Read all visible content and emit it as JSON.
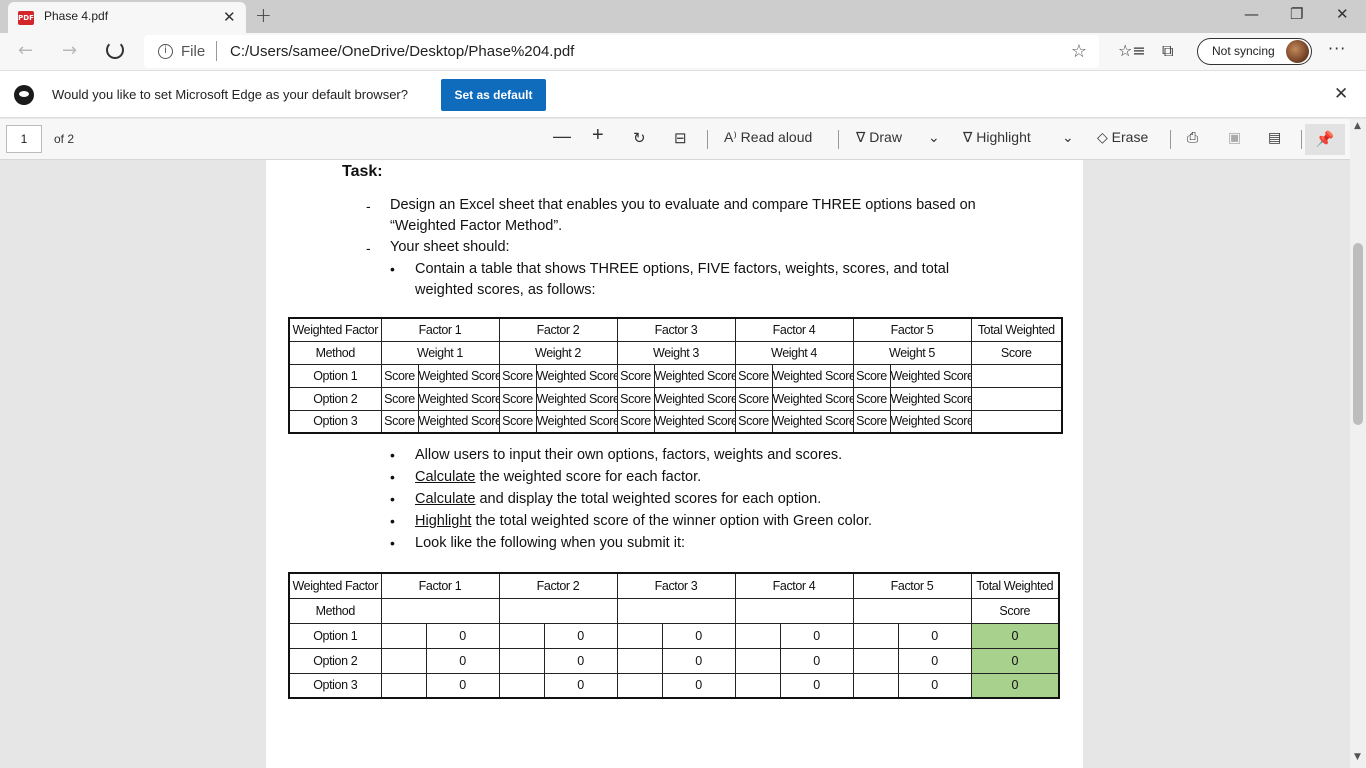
{
  "browser": {
    "tab_title": "Phase 4.pdf",
    "tab_icon_text": "PDF",
    "url_scheme_label": "File",
    "url": "C:/Users/samee/OneDrive/Desktop/Phase%204.pdf",
    "sync_label": "Not syncing"
  },
  "infobar": {
    "message": "Would you like to set Microsoft Edge as your default browser?",
    "button_label": "Set as default"
  },
  "pdf_toolbar": {
    "page_number": "1",
    "page_count": "of 2",
    "read_aloud": "Read aloud",
    "draw": "Draw",
    "highlight": "Highlight",
    "erase": "Erase"
  },
  "doc": {
    "task_heading": "Task:",
    "dash": "-",
    "item1_line1": "Design an Excel sheet that enables you to evaluate and compare THREE options based on",
    "item1_line2": "“Weighted Factor Method”.",
    "item2": "Your sheet should:",
    "bullet": "•",
    "sub1_line1": "Contain a table that shows THREE options, FIVE factors, weights, scores, and total",
    "sub1_line2": "weighted scores, as follows:",
    "req1": "Allow users to input their own options, factors, weights and scores.",
    "req2_u": "Calculate",
    "req2_rest": " the weighted score for each factor.",
    "req3_u": "Calculate",
    "req3_rest": " and display the total weighted scores for each option.",
    "req4_u": "Highlight",
    "req4_rest": " the total weighted score of the winner option with Green color.",
    "req5": "Look like the following when you submit it:"
  },
  "table1": {
    "corner_top": "Weighted Factor",
    "corner_bottom": "Method",
    "factors": [
      "Factor 1",
      "Factor 2",
      "Factor 3",
      "Factor 4",
      "Factor 5"
    ],
    "weights": [
      "Weight 1",
      "Weight 2",
      "Weight 3",
      "Weight 4",
      "Weight 5"
    ],
    "total_top": "Total Weighted",
    "total_bottom": "Score",
    "options": [
      "Option 1",
      "Option 2",
      "Option 3"
    ],
    "score_label": "Score",
    "weighted_score_label": "Weighted Score"
  },
  "table2": {
    "corner_top": "Weighted Factor",
    "corner_bottom": "Method",
    "factors": [
      "Factor 1",
      "Factor 2",
      "Factor 3",
      "Factor 4",
      "Factor 5"
    ],
    "total_top": "Total Weighted",
    "total_bottom": "Score",
    "options": [
      "Option 1",
      "Option 2",
      "Option 3"
    ],
    "cell_value": "0",
    "highlight_color": "#a9d18e"
  }
}
